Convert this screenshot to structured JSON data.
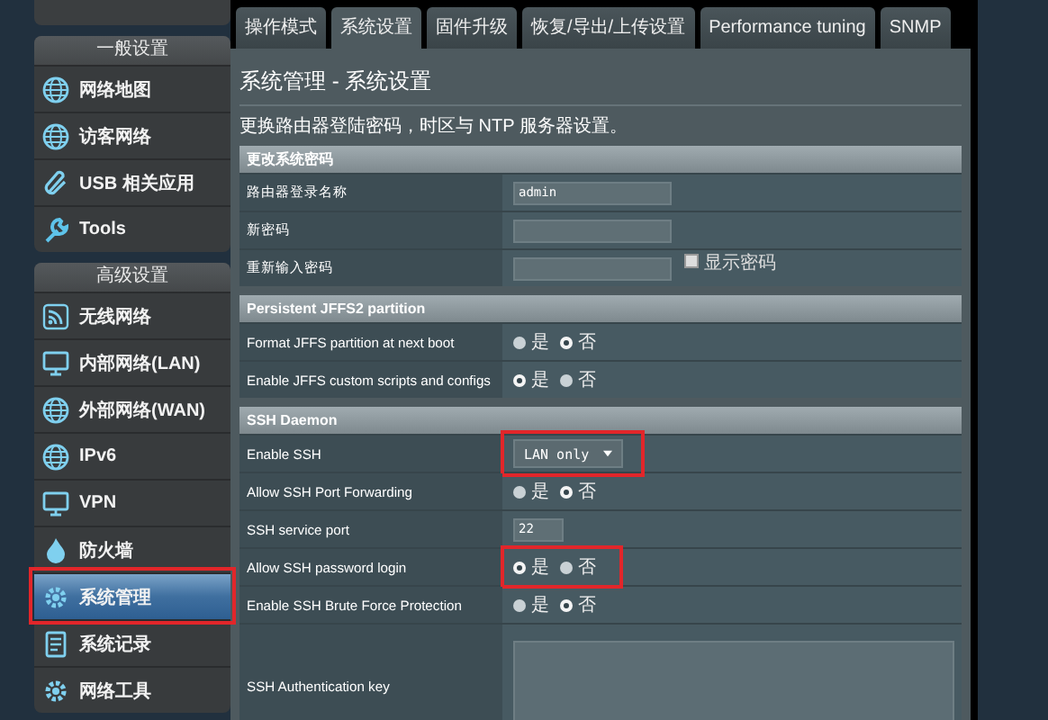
{
  "sidebar": {
    "groups": [
      {
        "title": "一般设置",
        "items": [
          {
            "label": "网络地图",
            "selected": false,
            "highlighted": false
          },
          {
            "label": "访客网络",
            "selected": false,
            "highlighted": false
          },
          {
            "label": "USB 相关应用",
            "selected": false,
            "highlighted": false
          },
          {
            "label": "Tools",
            "selected": false,
            "highlighted": false
          }
        ]
      },
      {
        "title": "高级设置",
        "items": [
          {
            "label": "无线网络",
            "selected": false,
            "highlighted": false
          },
          {
            "label": "内部网络(LAN)",
            "selected": false,
            "highlighted": false
          },
          {
            "label": "外部网络(WAN)",
            "selected": false,
            "highlighted": false
          },
          {
            "label": "IPv6",
            "selected": false,
            "highlighted": false
          },
          {
            "label": "VPN",
            "selected": false,
            "highlighted": false
          },
          {
            "label": "防火墙",
            "selected": false,
            "highlighted": false
          },
          {
            "label": "系统管理",
            "selected": true,
            "highlighted": true
          },
          {
            "label": "系统记录",
            "selected": false,
            "highlighted": false
          },
          {
            "label": "网络工具",
            "selected": false,
            "highlighted": false
          }
        ]
      }
    ]
  },
  "tabs": [
    {
      "label": "操作模式",
      "selected": false
    },
    {
      "label": "系统设置",
      "selected": true
    },
    {
      "label": "固件升级",
      "selected": false
    },
    {
      "label": "恢复/导出/上传设置",
      "selected": false
    },
    {
      "label": "Performance tuning",
      "selected": false
    },
    {
      "label": "SNMP",
      "selected": false
    }
  ],
  "page": {
    "title": "系统管理 - 系统设置",
    "description": "更换路由器登陆密码，时区与 NTP 服务器设置。"
  },
  "sections": [
    {
      "title": "更改系统密码",
      "rows": [
        {
          "kind": "text",
          "label": "路由器登录名称",
          "value": "admin"
        },
        {
          "kind": "password",
          "label": "新密码"
        },
        {
          "kind": "password",
          "label": "重新输入密码",
          "show_password": {
            "label": "显示密码",
            "checked": false
          }
        }
      ]
    },
    {
      "title": "Persistent JFFS2 partition",
      "rows": [
        {
          "kind": "radio",
          "label": "Format JFFS partition at next boot",
          "options": [
            {
              "label": "是",
              "selected": false
            },
            {
              "label": "否",
              "selected": true
            }
          ]
        },
        {
          "kind": "radio",
          "label": "Enable JFFS custom scripts and configs",
          "options": [
            {
              "label": "是",
              "selected": true
            },
            {
              "label": "否",
              "selected": false
            }
          ]
        }
      ]
    },
    {
      "title": "SSH Daemon",
      "rows": [
        {
          "kind": "select",
          "label": "Enable SSH",
          "value": "LAN only",
          "highlighted": true
        },
        {
          "kind": "radio",
          "label": "Allow SSH Port Forwarding",
          "options": [
            {
              "label": "是",
              "selected": false
            },
            {
              "label": "否",
              "selected": true
            }
          ]
        },
        {
          "kind": "port",
          "label": "SSH service port",
          "value": "22"
        },
        {
          "kind": "radio",
          "label": "Allow SSH password login",
          "highlighted": true,
          "options": [
            {
              "label": "是",
              "selected": true
            },
            {
              "label": "否",
              "selected": false
            }
          ]
        },
        {
          "kind": "radio",
          "label": "Enable SSH Brute Force Protection",
          "options": [
            {
              "label": "是",
              "selected": false
            },
            {
              "label": "否",
              "selected": true
            }
          ]
        },
        {
          "kind": "textarea",
          "label": "SSH Authentication key"
        }
      ]
    }
  ]
}
